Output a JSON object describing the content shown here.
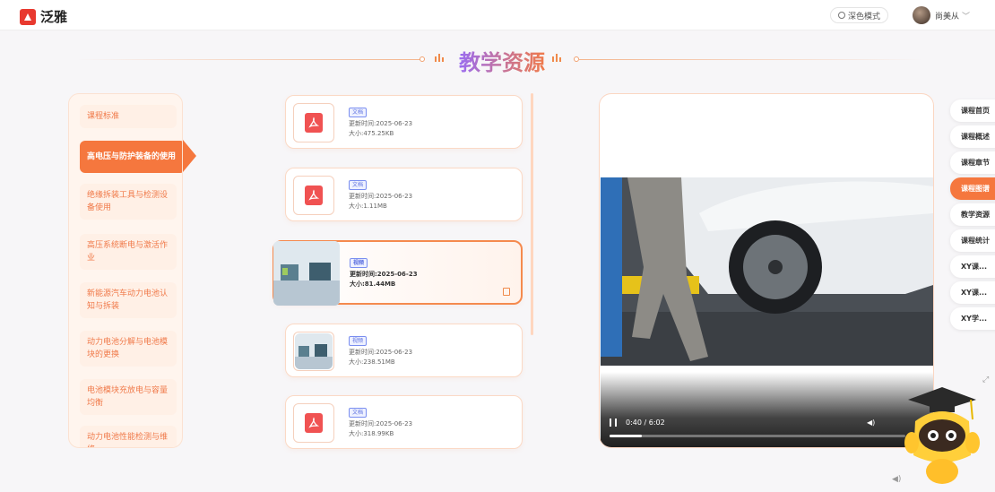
{
  "app": {
    "name": "泛雅"
  },
  "header": {
    "dark_mode_label": "深色模式",
    "user_name": "尚美从",
    "chevron": "﹀"
  },
  "page_title": "教学资源",
  "chapters": [
    {
      "label": "课程标准",
      "active": false
    },
    {
      "label": "高电压与防护装备的使用",
      "active": true
    },
    {
      "label": "绝缘拆装工具与检测设备使用",
      "active": false
    },
    {
      "label": "高压系统断电与激活作业",
      "active": false
    },
    {
      "label": "新能源汽车动力电池认知与拆装",
      "active": false
    },
    {
      "label": "动力电池分解与电池模块的更换",
      "active": false
    },
    {
      "label": "电池模块充放电与容量均衡",
      "active": false
    },
    {
      "label": "动力电池性能检测与维修",
      "active": false
    }
  ],
  "resources": [
    {
      "type": "文档",
      "icon": "pdf-icon",
      "updated": "更新时间:2025-06-23",
      "size": "大小:475.25KB"
    },
    {
      "type": "文档",
      "icon": "pdf-icon",
      "updated": "更新时间:2025-06-23",
      "size": "大小:1.11MB"
    },
    {
      "type": "视频",
      "icon": "video-thumbnail",
      "updated": "更新时间:2025-06-23",
      "size": "大小:81.44MB",
      "active": true
    },
    {
      "type": "视频",
      "icon": "video-thumbnail",
      "updated": "更新时间:2025-06-23",
      "size": "大小:238.51MB"
    },
    {
      "type": "文档",
      "icon": "pdf-icon",
      "updated": "更新时间:2025-06-23",
      "size": "大小:318.99KB"
    }
  ],
  "video": {
    "current_time": "0:40",
    "duration": "6:02",
    "time_display": "0:40 / 6:02",
    "progress": 0.11
  },
  "right_nav": [
    {
      "label": "课程首页"
    },
    {
      "label": "课程概述"
    },
    {
      "label": "课程章节"
    },
    {
      "label": "课程图谱",
      "active": true
    },
    {
      "label": "教学资源"
    },
    {
      "label": "课程统计"
    },
    {
      "label": "XY课..."
    },
    {
      "label": "XY课..."
    },
    {
      "label": "XY学..."
    }
  ],
  "colors": {
    "accent": "#f5773e",
    "pdf": "#f05252",
    "title_start": "#9a6cf0",
    "title_end": "#f07a4a"
  }
}
